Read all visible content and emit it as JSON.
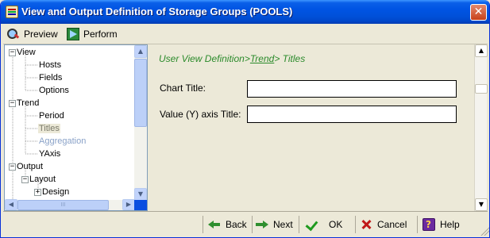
{
  "window": {
    "title": "View and Output Definition of Storage Groups (POOLS)",
    "close_glyph": "✕"
  },
  "toolbar": {
    "preview_label": "Preview",
    "perform_label": "Perform"
  },
  "tree": {
    "items": [
      {
        "label": "View",
        "level": 0,
        "expander": "−"
      },
      {
        "label": "Hosts",
        "level": 1
      },
      {
        "label": "Fields",
        "level": 1
      },
      {
        "label": "Options",
        "level": 1
      },
      {
        "label": "Trend",
        "level": 0,
        "expander": "−"
      },
      {
        "label": "Period",
        "level": 1
      },
      {
        "label": "Titles",
        "level": 1,
        "state": "selected"
      },
      {
        "label": "Aggregation",
        "level": 1,
        "state": "disabled"
      },
      {
        "label": "YAxis",
        "level": 1
      },
      {
        "label": "Output",
        "level": 0,
        "expander": "−"
      },
      {
        "label": "Layout",
        "level": 1,
        "expander": "−"
      },
      {
        "label": "Design",
        "level": 2,
        "expander": "+"
      }
    ],
    "hscroll_grip": "III"
  },
  "content": {
    "breadcrumb_prefix": "User View Definition>",
    "breadcrumb_link": "Trend",
    "breadcrumb_suffix": "> Titles",
    "chart_title_label": "Chart Title:",
    "chart_title_value": "",
    "value_axis_label": "Value (Y) axis Title:",
    "value_axis_value": ""
  },
  "buttons": {
    "back": "Back",
    "next": "Next",
    "ok": "OK",
    "cancel": "Cancel",
    "help": "Help"
  },
  "colors": {
    "breadcrumb": "#2a8a2a",
    "titlebar": "#0054e3",
    "disabled_item": "#8aa2c8"
  }
}
